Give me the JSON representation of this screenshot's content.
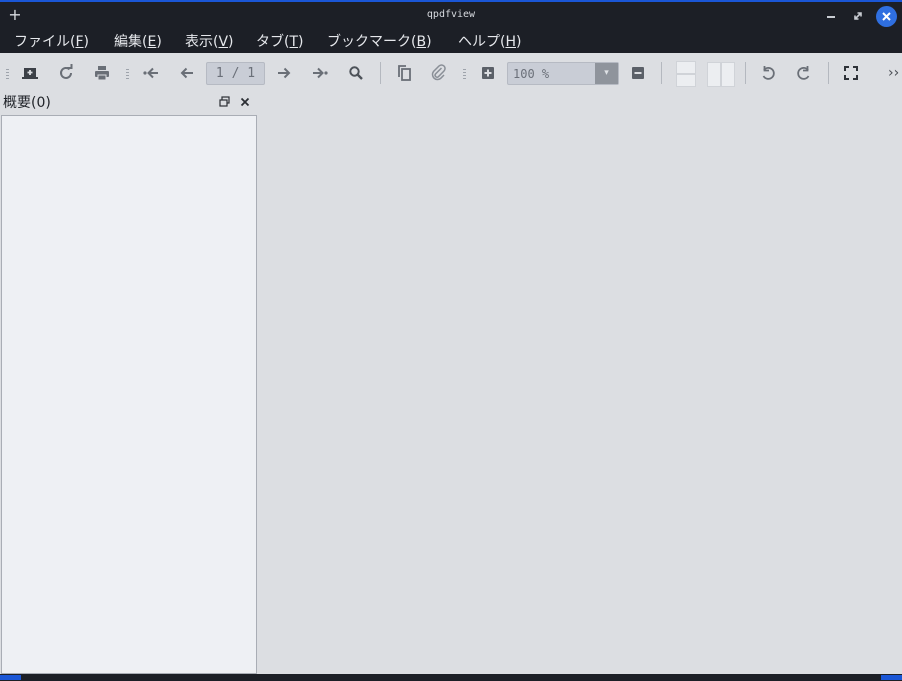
{
  "window": {
    "title": "qpdfview",
    "accent_color": "#1a56d6",
    "new_tab_icon": "plus-icon",
    "minimize_icon": "minimize-icon",
    "maximize_icon": "maximize-icon",
    "close_icon": "close-icon"
  },
  "menubar": {
    "items": [
      {
        "label": "ファイル(",
        "key": "F",
        "tail": ")"
      },
      {
        "label": "編集(",
        "key": "E",
        "tail": ")"
      },
      {
        "label": "表示(",
        "key": "V",
        "tail": ")"
      },
      {
        "label": "タブ(",
        "key": "T",
        "tail": ")"
      },
      {
        "label": "ブックマーク(",
        "key": "B",
        "tail": ")"
      },
      {
        "label": "ヘルプ(",
        "key": "H",
        "tail": ")"
      }
    ]
  },
  "toolbar": {
    "page_indicator": "1 / 1",
    "zoom_value": "100 %",
    "zoom_dropdown_icon": "dropdown-arrow-icon",
    "icons": [
      "open-file-icon",
      "reload-icon",
      "print-icon",
      "first-page-icon",
      "previous-page-icon",
      "next-page-icon",
      "last-page-icon",
      "search-icon",
      "copy-icon",
      "attachment-icon",
      "zoom-in-icon",
      "zoom-out-icon",
      "single-page-layout-icon",
      "two-page-layout-icon",
      "rotate-left-icon",
      "rotate-right-icon",
      "fullscreen-icon",
      "overflow-icon"
    ]
  },
  "dock": {
    "title": "概要(0)",
    "float_icon": "float-icon",
    "close_icon": "close-icon"
  }
}
